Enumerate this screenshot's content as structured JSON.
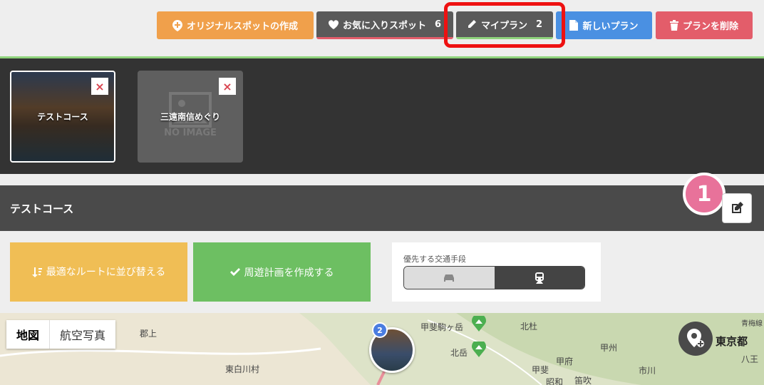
{
  "toolbar": {
    "original_spot": "オリジナルスポットの作成",
    "favorite_spot": "お気に入りスポット",
    "favorite_count": "6",
    "my_plan": "マイプラン",
    "my_plan_count": "2",
    "new_plan": "新しいプラン",
    "delete_plan": "プランを削除"
  },
  "plans": [
    {
      "title": "テストコース",
      "close": "×"
    },
    {
      "title": "三遠南信めぐり",
      "close": "×",
      "placeholder": "NO IMAGE"
    }
  ],
  "course": {
    "title": "テストコース",
    "badge": "1"
  },
  "actions": {
    "sort_label": "最適なルートに並び替える",
    "create_plan": "周遊計画を作成する",
    "transport_label": "優先する交通手段"
  },
  "map": {
    "toggle_map": "地図",
    "toggle_aerial": "航空写真",
    "pin_count": "2",
    "labels": [
      "郡上",
      "東白川村",
      "甲斐駒ヶ岳",
      "北杜",
      "北岳",
      "甲府",
      "甲斐",
      "甲州",
      "昭和",
      "笛吹",
      "市川",
      "東京都",
      "八王",
      "青梅線"
    ]
  },
  "colors": {
    "orange": "#f0a04b",
    "dark": "#5a5a5a",
    "blue": "#4a90e2",
    "red": "#e35d6a",
    "green": "#6dbf62",
    "yellow": "#f0be55",
    "highlight": "#ee1111",
    "badge": "#e8729a"
  }
}
